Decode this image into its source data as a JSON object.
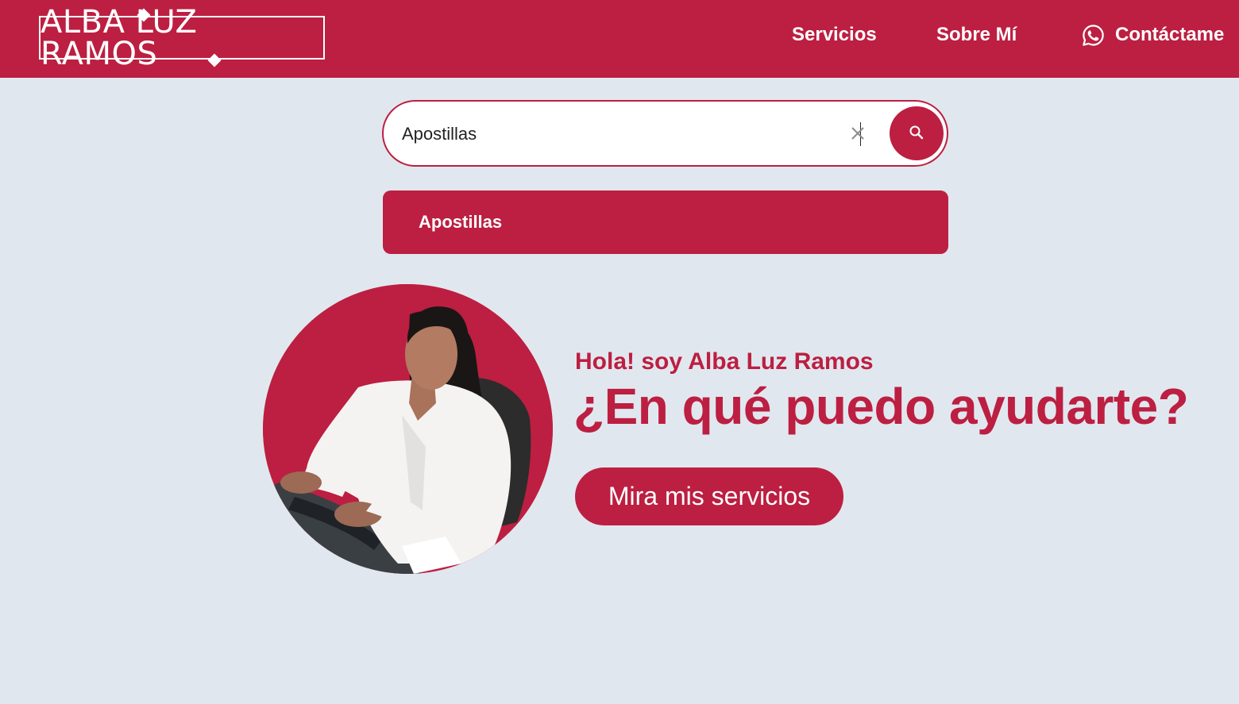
{
  "header": {
    "logo_text": "ALBA LUZ RAMOS",
    "nav": {
      "servicios": "Servicios",
      "sobre_mi": "Sobre Mí",
      "contacto": "Contáctame"
    }
  },
  "search": {
    "value": "Apostillas",
    "suggestions": [
      "Apostillas"
    ]
  },
  "hero": {
    "greeting": "Hola! soy Alba Luz Ramos",
    "headline": "¿En qué puedo ayudarte?",
    "cta_label": "Mira mis servicios"
  },
  "colors": {
    "brand": "#bc1f41",
    "background": "#e1e7ef",
    "text_light": "#ffffff"
  },
  "icons": {
    "contact": "whatsapp-icon",
    "clear": "close-icon",
    "search": "search-icon"
  }
}
